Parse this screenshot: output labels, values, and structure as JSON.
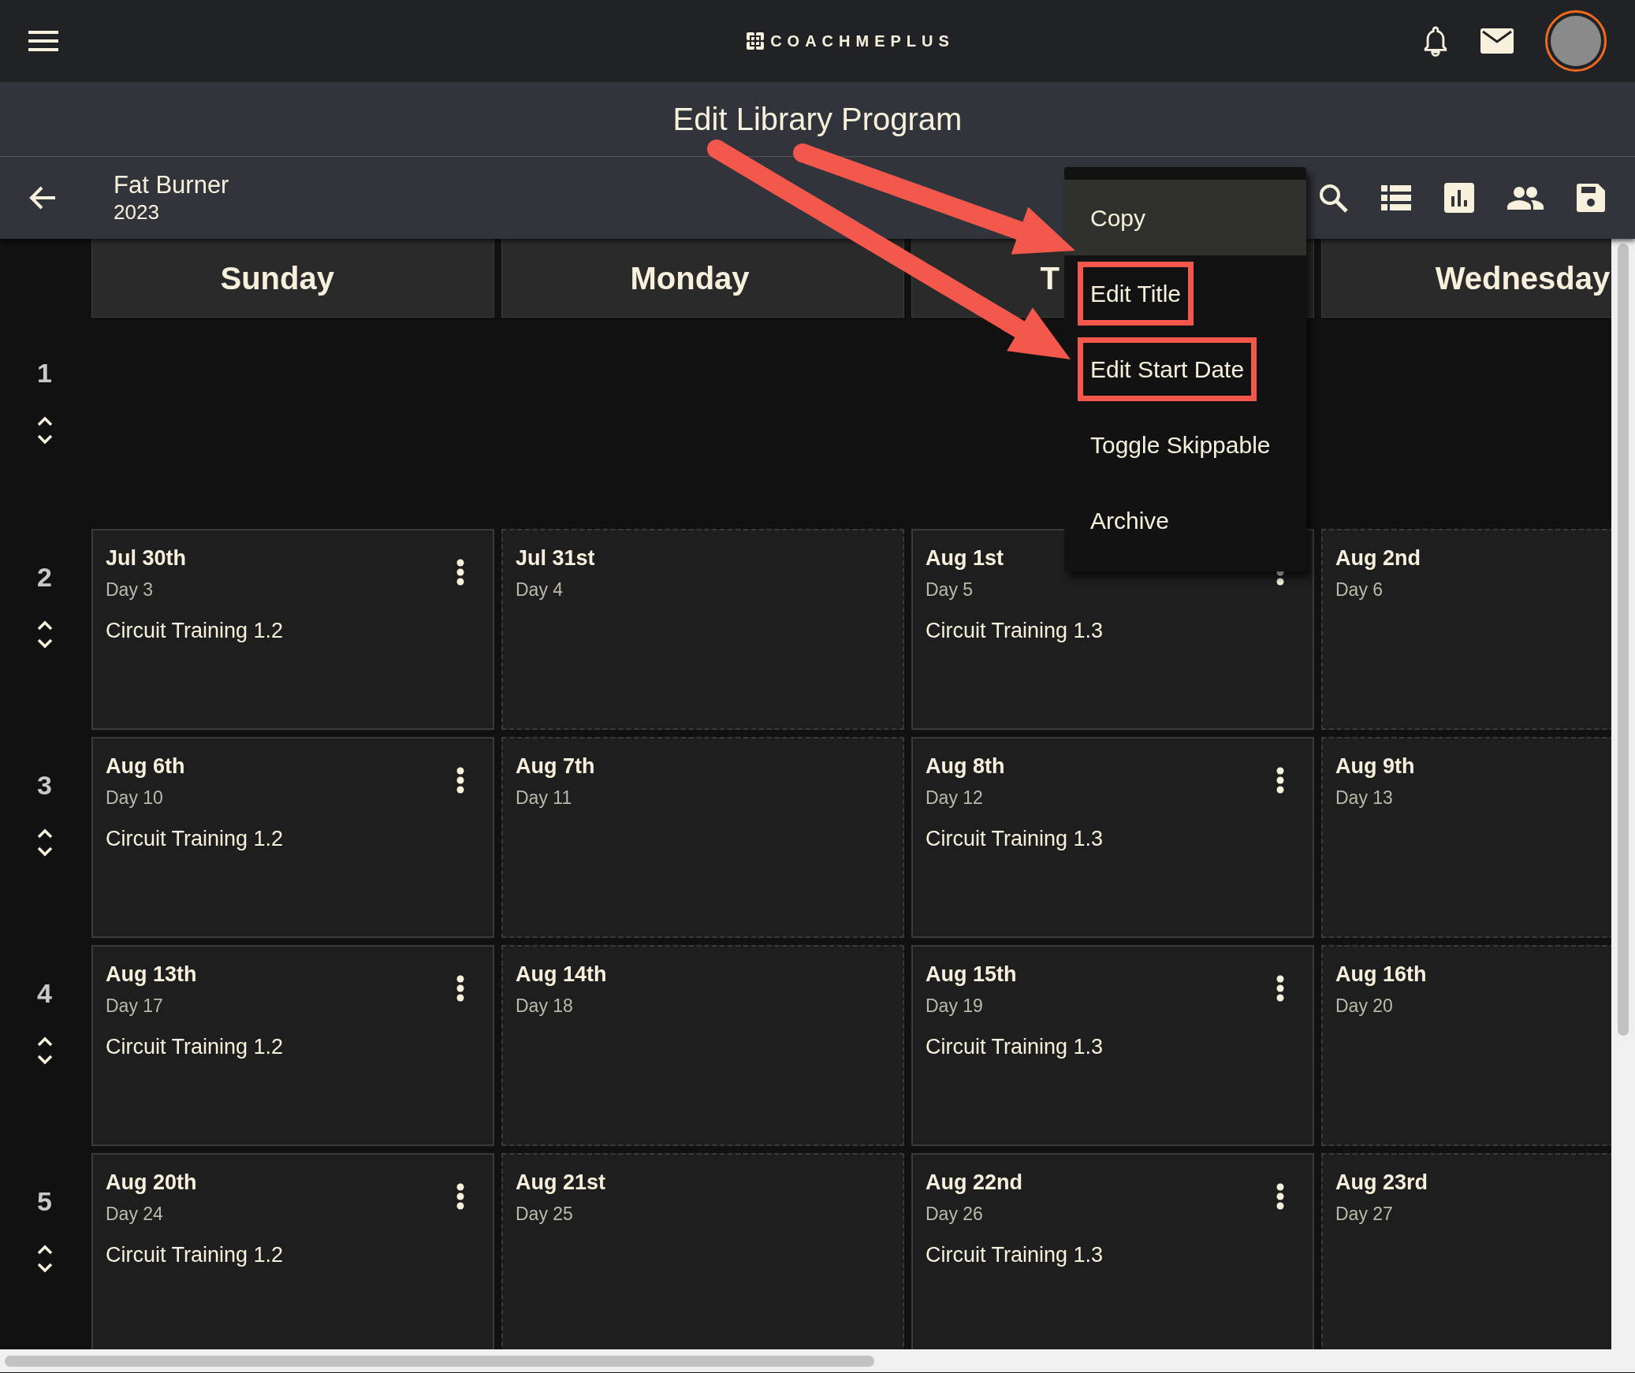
{
  "top_bar": {
    "logo_text": "COACHMEPLUS"
  },
  "page_title": "Edit Library Program",
  "program": {
    "name": "Fat Burner",
    "year": "2023"
  },
  "day_headers": [
    "Sunday",
    "Monday",
    "T",
    "Wednesday"
  ],
  "weeks": [
    {
      "number": "1"
    },
    {
      "number": "2",
      "days": [
        {
          "date": "Jul 30th",
          "day": "Day 3",
          "workout": "Circuit Training 1.2"
        },
        {
          "date": "Jul 31st",
          "day": "Day 4"
        },
        {
          "date": "Aug 1st",
          "day": "Day 5",
          "workout": "Circuit Training 1.3"
        },
        {
          "date": "Aug 2nd",
          "day": "Day 6"
        }
      ]
    },
    {
      "number": "3",
      "days": [
        {
          "date": "Aug 6th",
          "day": "Day 10",
          "workout": "Circuit Training 1.2"
        },
        {
          "date": "Aug 7th",
          "day": "Day 11"
        },
        {
          "date": "Aug 8th",
          "day": "Day 12",
          "workout": "Circuit Training 1.3"
        },
        {
          "date": "Aug 9th",
          "day": "Day 13"
        }
      ]
    },
    {
      "number": "4",
      "days": [
        {
          "date": "Aug 13th",
          "day": "Day 17",
          "workout": "Circuit Training 1.2"
        },
        {
          "date": "Aug 14th",
          "day": "Day 18"
        },
        {
          "date": "Aug 15th",
          "day": "Day 19",
          "workout": "Circuit Training 1.3"
        },
        {
          "date": "Aug 16th",
          "day": "Day 20"
        }
      ]
    },
    {
      "number": "5",
      "days": [
        {
          "date": "Aug 20th",
          "day": "Day 24",
          "workout": "Circuit Training 1.2"
        },
        {
          "date": "Aug 21st",
          "day": "Day 25"
        },
        {
          "date": "Aug 22nd",
          "day": "Day 26",
          "workout": "Circuit Training 1.3"
        },
        {
          "date": "Aug 23rd",
          "day": "Day 27"
        }
      ]
    }
  ],
  "context_menu": {
    "items": [
      {
        "label": "Copy",
        "selected": true,
        "annotated": false
      },
      {
        "label": "Edit Title",
        "selected": false,
        "annotated": true
      },
      {
        "label": "Edit Start Date",
        "selected": false,
        "annotated": true
      },
      {
        "label": "Toggle Skippable",
        "selected": false,
        "annotated": false
      },
      {
        "label": "Archive",
        "selected": false,
        "annotated": false
      }
    ]
  }
}
